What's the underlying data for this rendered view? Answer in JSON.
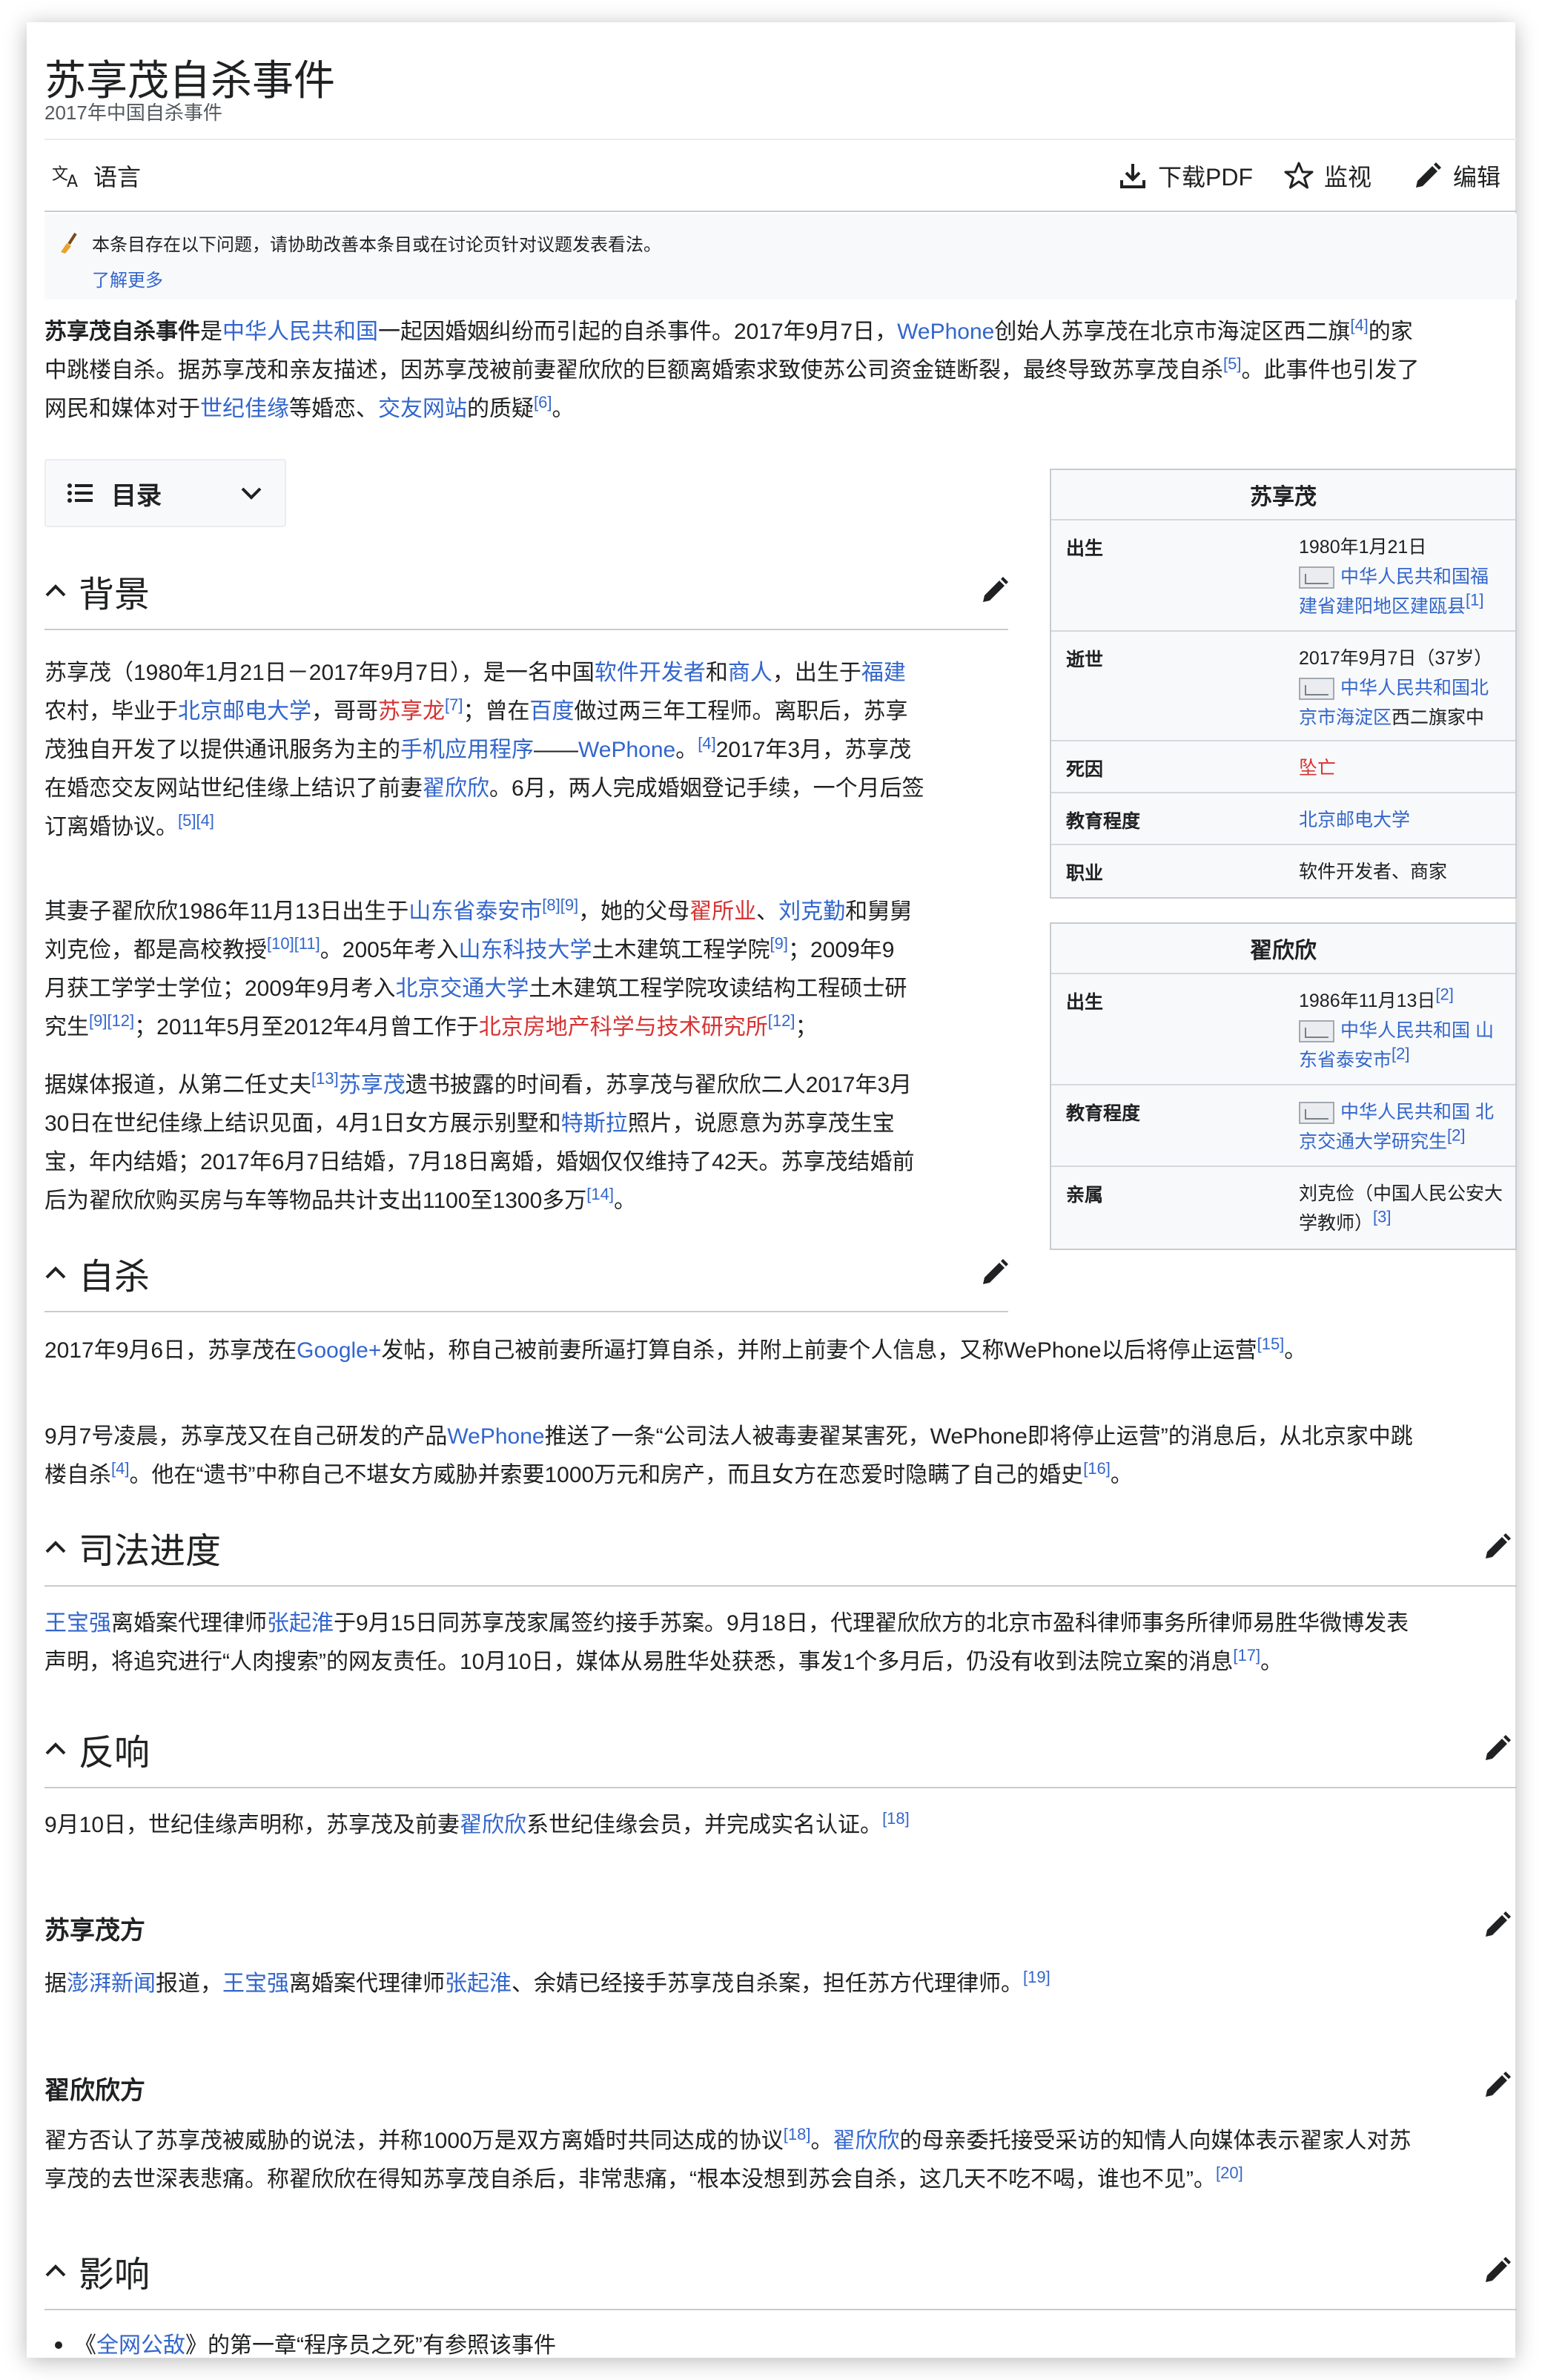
{
  "header": {
    "title": "苏享茂自杀事件",
    "subtitle": "2017年中国自杀事件"
  },
  "toolbar": {
    "language": "语言",
    "download_pdf": "下载PDF",
    "watch": "监视",
    "edit": "编辑"
  },
  "notice": {
    "text": "本条目存在以下问题，请协助改善本条目或在讨论页针对议题发表看法。",
    "learn_more": "了解更多"
  },
  "intro": {
    "t1_bold": "苏享茂自杀事件",
    "t2": "是",
    "l_prc": "中华人民共和国",
    "t3": "一起因婚姻纠纷而引起的自杀事件。2017年9月7日，",
    "l_wephone": "WePhone",
    "t4": "创始人苏享茂在北京市海淀区西二旗",
    "r4": "[4]",
    "t5": "的家",
    "t6": "中跳楼自杀。据苏享茂和亲友描述，因苏享茂被前妻翟欣欣的巨额离婚索求致使苏公司资金链断裂，最终导致苏享茂自杀",
    "r5": "[5]",
    "t7": "。此事件也引发了",
    "t8": "网民和媒体对于",
    "l_sjjy": "世纪佳缘",
    "t9": "等婚恋、",
    "l_jywz": "交友网站",
    "t10": "的质疑",
    "r6": "[6]",
    "t11": "。"
  },
  "toc": {
    "label": "目录"
  },
  "sections": {
    "background": "背景",
    "suicide": "自杀",
    "judicial": "司法进度",
    "reaction": "反响",
    "su_side": "苏享茂方",
    "zhai_side": "翟欣欣方",
    "impact": "影响"
  },
  "bg1": {
    "a1": "苏享茂（1980年1月21日－2017年9月7日），是一名中国",
    "l_dev": "软件开发者",
    "a2": "和",
    "l_biz": "商人",
    "a3": "，出生于",
    "l_fj": "福建",
    "b1": "农村，毕业于",
    "l_bupt": "北京邮电大学",
    "b2": "，哥哥",
    "l_sxl": "苏享龙",
    "r7": "[7]",
    "b3": "；曾在",
    "l_baidu": "百度",
    "b4": "做过两三年工程师。离职后，苏享",
    "c1": "茂独自开发了以提供通讯服务为主的",
    "l_app": "手机应用程序",
    "c2": "——",
    "l_wp": "WePhone",
    "c3": "。",
    "r4": "[4]",
    "c4": "2017年3月，苏享茂",
    "d1": "在婚恋交友网站世纪佳缘上结识了前妻",
    "l_zxx": "翟欣欣",
    "d2": "。6月，两人完成婚姻登记手续，一个月后签",
    "e1": "订离婚协议。",
    "r54": "[5][4]"
  },
  "bg2": {
    "a1": "其妻子翟欣欣1986年11月13日出生于",
    "l_taian": "山东省泰安市",
    "r89": "[8][9]",
    "a2": "，她的父母",
    "l_zsy": "翟所业",
    "a3": "、",
    "l_lkq": "刘克勤",
    "a4": "和舅舅",
    "b1": "刘克俭，都是高校教授",
    "r1011": "[10][11]",
    "b2": "。2005年考入",
    "l_sdkj": "山东科技大学",
    "b3": "土木建筑工程学院",
    "r9": "[9]",
    "b4": "；2009年9",
    "c1": "月获工学学士学位；2009年9月考入",
    "l_bjtu": "北京交通大学",
    "c2": "土木建筑工程学院攻读结构工程硕士研",
    "d1": "究生",
    "r912": "[9][12]",
    "d2": "；2011年5月至2012年4月曾工作于",
    "l_bjfdc": "北京房地产科学与技术研究所",
    "r12": "[12]",
    "d3": "；"
  },
  "bg3": {
    "a1": "据媒体报道，从第二任丈夫",
    "r13": "[13]",
    "l_sxm": "苏享茂",
    "a2": "遗书披露的时间看，苏享茂与翟欣欣二人2017年3月",
    "b1": "30日在世纪佳缘上结识见面，4月1日女方展示别墅和",
    "l_tesla": "特斯拉",
    "b2": "照片，说愿意为苏享茂生宝",
    "c1": "宝，年内结婚；2017年6月7日结婚，7月18日离婚，婚姻仅仅维持了42天。苏享茂结婚前",
    "d1": "后为翟欣欣购买房与车等物品共计支出1100至1300多万",
    "r14": "[14]",
    "d2": "。"
  },
  "suicide": {
    "p1a": "2017年9月6日，苏享茂在",
    "l_gplus": "Google+",
    "p1b": "发帖，称自己被前妻所逼打算自杀，并附上前妻个人信息，又称WePhone以后将停止运营",
    "r15": "[15]",
    "p1c": "。",
    "p2a": "9月7号凌晨，苏享茂又在自己研发的产品",
    "l_wp": "WePhone",
    "p2b": "推送了一条“公司法人被毒妻翟某害死，WePhone即将停止运营”的消息后，从北京家中跳",
    "p2c": "楼自杀",
    "r4": "[4]",
    "p2d": "。他在“遗书”中称自己不堪女方威胁并索要1000万元和房产，而且女方在恋爱时隐瞒了自己的婚史",
    "r16": "[16]",
    "p2e": "。"
  },
  "judicial": {
    "l_wbq": "王宝强",
    "a1": "离婚案代理律师",
    "l_zqh": "张起淮",
    "a2": "于9月15日同苏享茂家属签约接手苏案。9月18日，代理翟欣欣方的北京市盈科律师事务所律师易胜华微博发表",
    "b1": "声明，将追究进行“人肉搜索”的网友责任。10月10日，媒体从易胜华处获悉，事发1个多月后，仍没有收到法院立案的消息",
    "r17": "[17]",
    "b2": "。"
  },
  "reaction": {
    "a1": "9月10日，世纪佳缘声明称，苏享茂及前妻",
    "l_zxx": "翟欣欣",
    "a2": "系世纪佳缘会员，并完成实名认证。",
    "r18": "[18]"
  },
  "su_side": {
    "a1": "据",
    "l_pp": "澎湃新闻",
    "a2": "报道，",
    "l_wbq": "王宝强",
    "a3": "离婚案代理律师",
    "l_zqh": "张起淮",
    "a4": "、余婧已经接手苏享茂自杀案，担任苏方代理律师。",
    "r19": "[19]"
  },
  "zhai_side": {
    "a1": "翟方否认了苏享茂被威胁的说法，并称1000万是双方离婚时共同达成的协议",
    "r18": "[18]",
    "a2": "。",
    "l_zxx": "翟欣欣",
    "a3": "的母亲委托接受采访的知情人向媒体表示翟家人对苏",
    "b1": "享茂的去世深表悲痛。称翟欣欣在得知苏享茂自杀后，非常悲痛，“根本没想到苏会自杀，这几天不吃不喝，谁也不见”。",
    "r20": "[20]"
  },
  "impact": {
    "a1": "《",
    "l_qwgs": "全网公敌",
    "a2": "》的第一章“程序员之死”有参照该事件"
  },
  "infobox1": {
    "title": "苏享茂",
    "rows": [
      {
        "label": "出生",
        "line1": "1980年1月21日",
        "link": "中华人民共和国福建省建阳地区建瓯县",
        "ref": "[1]"
      },
      {
        "label": "逝世",
        "line1": "2017年9月7日（37岁）",
        "link": "中华人民共和国北京市海淀区",
        "tail": "西二旗家中"
      },
      {
        "label": "死因",
        "value": "坠亡"
      },
      {
        "label": "教育程度",
        "value": "北京邮电大学"
      },
      {
        "label": "职业",
        "value": "软件开发者、商家"
      }
    ]
  },
  "infobox2": {
    "title": "翟欣欣",
    "rows": [
      {
        "label": "出生",
        "line1": "1986年11月13日",
        "ref1": "[2]",
        "link": "中华人民共和国 山东省泰安市",
        "ref": "[2]"
      },
      {
        "label": "教育程度",
        "link": "中华人民共和国 北京交通大学研究生",
        "ref": "[2]"
      },
      {
        "label": "亲属",
        "value": "刘克俭（中国人民公安大学教师）",
        "ref": "[3]"
      }
    ]
  },
  "colors": {
    "link": "#3366cc",
    "redlink": "#d73333",
    "text": "#202122",
    "border": "#c8ccd1"
  }
}
